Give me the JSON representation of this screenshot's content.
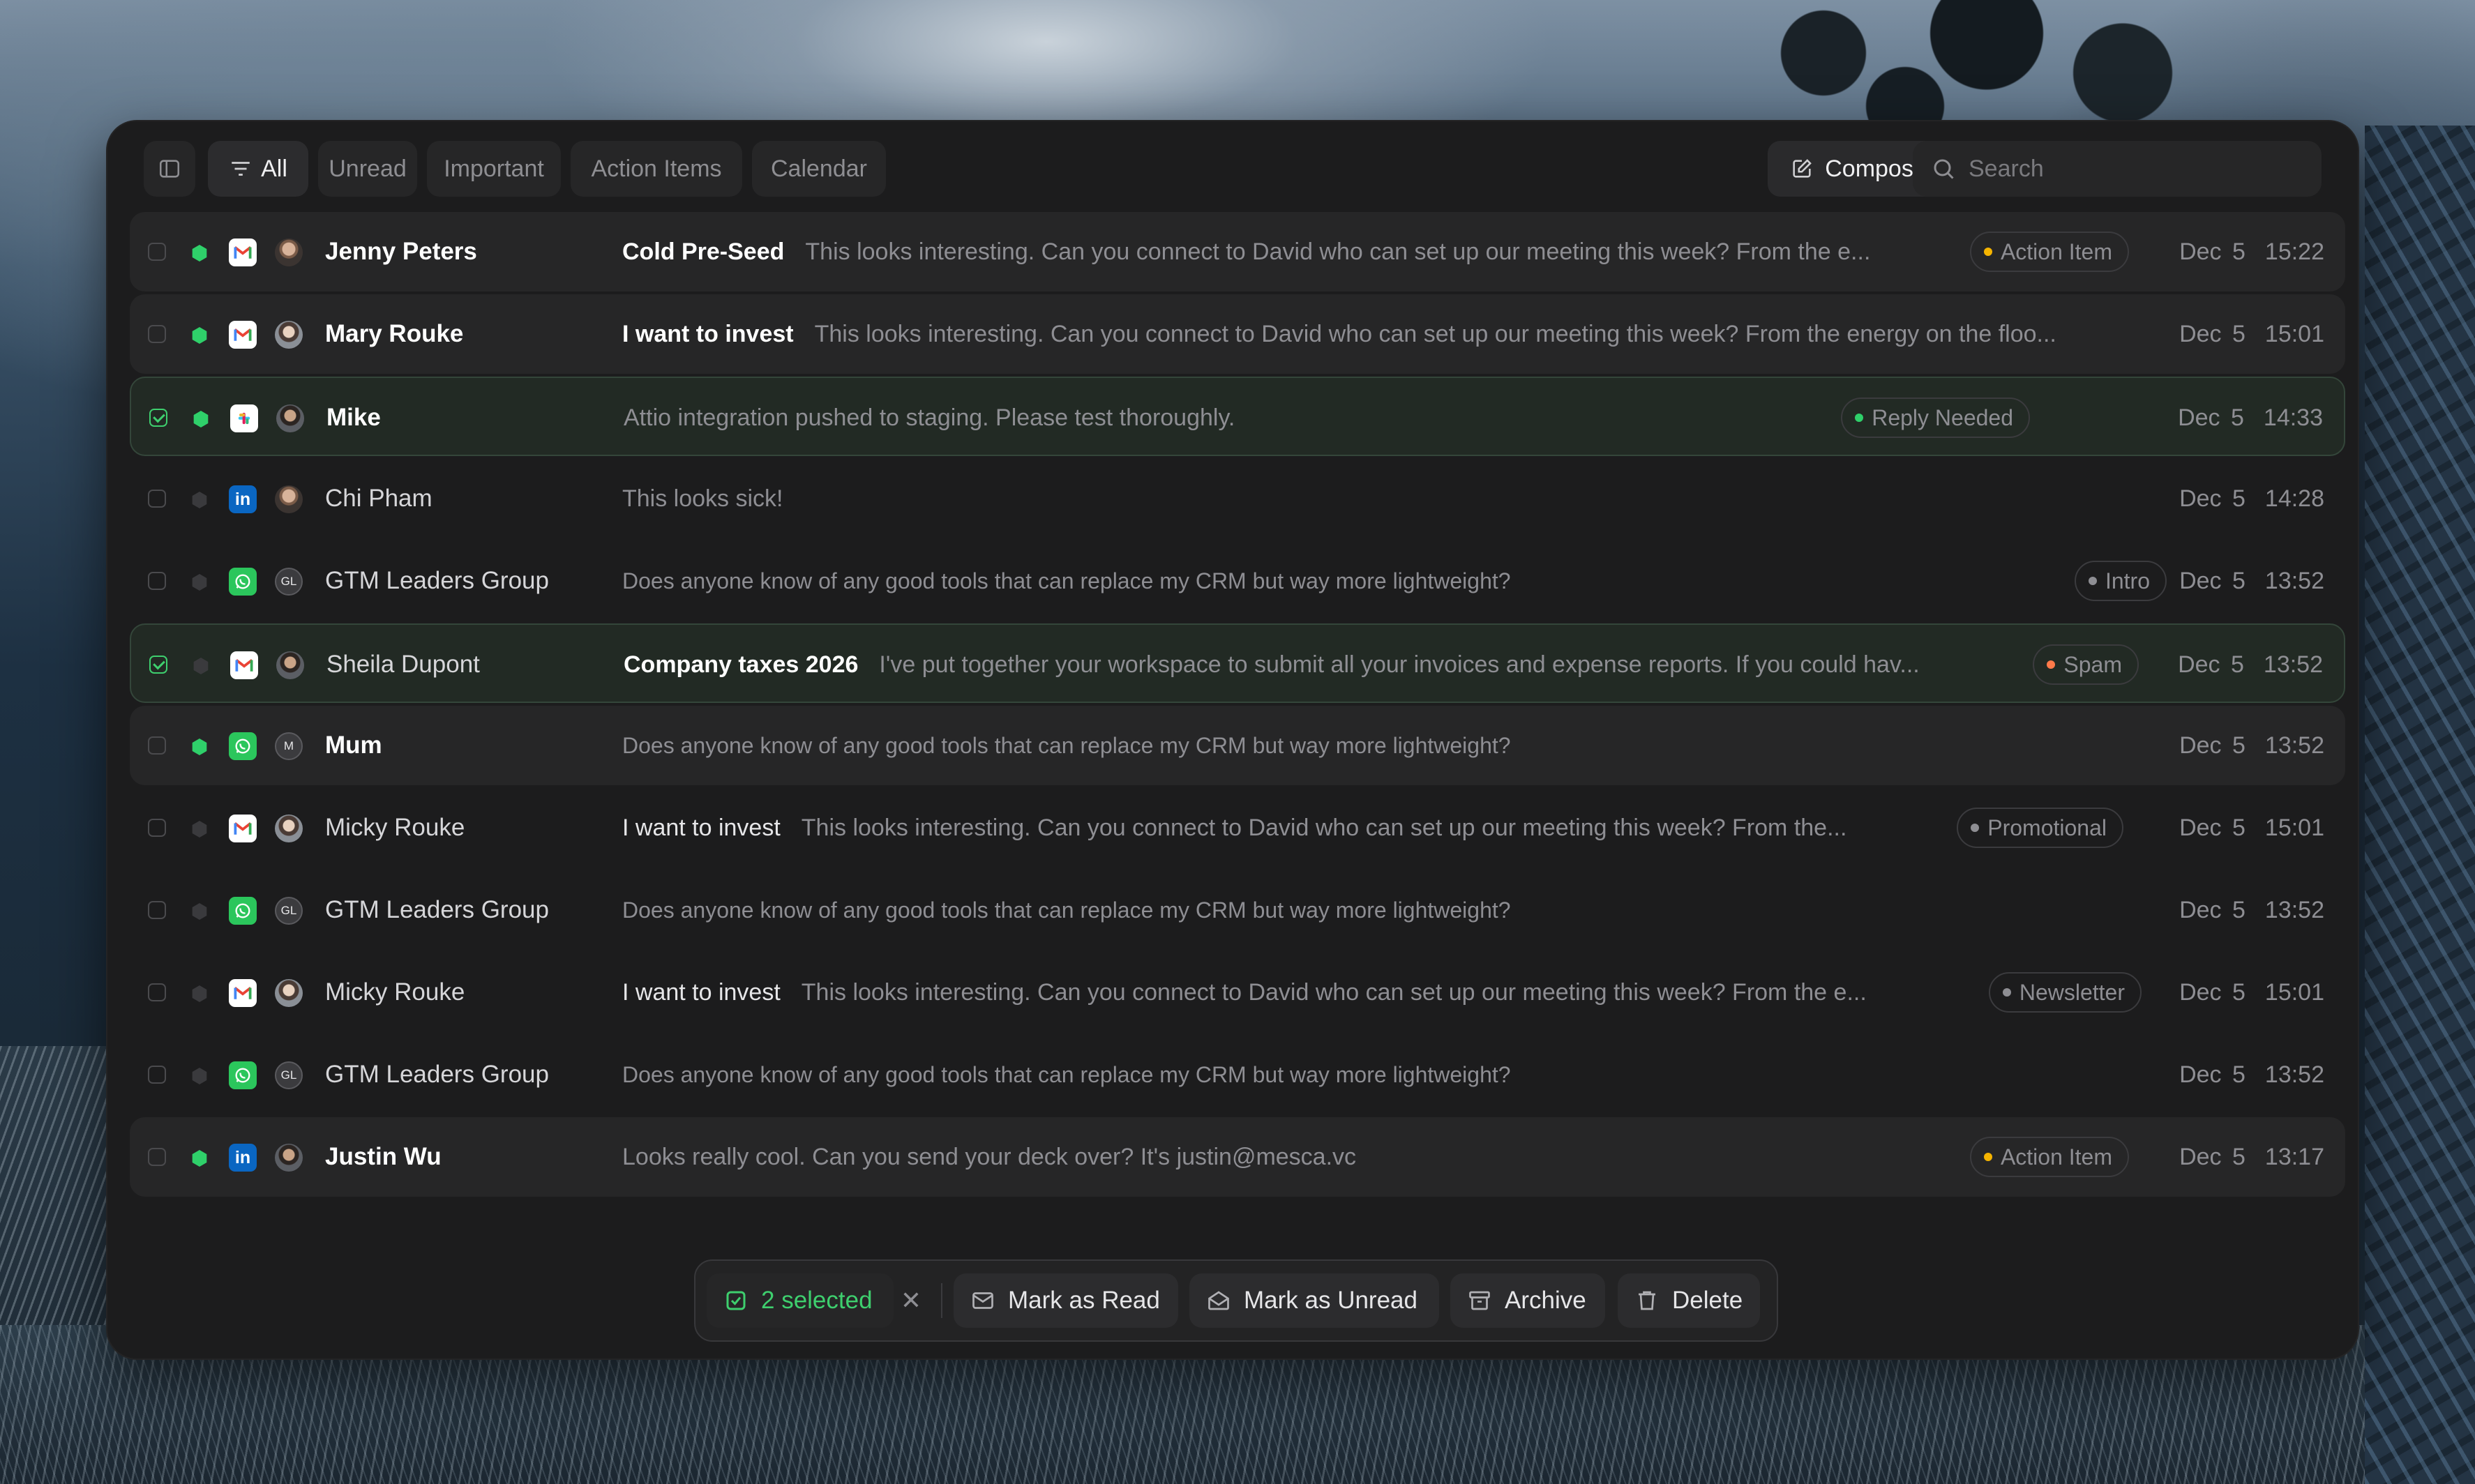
{
  "toolbar": {
    "filters": [
      "All",
      "Unread",
      "Important",
      "Action Items",
      "Calendar"
    ],
    "compose_label": "Compose",
    "search_placeholder": "Search"
  },
  "colors": {
    "unread_dot": "#2fd06a",
    "selected_accent": "#3ecf6e",
    "tag_action_item": "#f5b400",
    "tag_reply_needed": "#2fd06a",
    "tag_spam": "#ff7a4a",
    "tag_neutral": "#8e8e93"
  },
  "messages": [
    {
      "checked": false,
      "unread": true,
      "app": "gmail",
      "avatar": "photo",
      "sender": "Jenny Peters",
      "subject": "Cold Pre-Seed",
      "preview": "This looks interesting. Can you connect to David who can set up our meeting this week? From the e...",
      "tag": "Action Item",
      "tag_color": "action",
      "date": "Dec 5",
      "time": "15:22"
    },
    {
      "checked": false,
      "unread": true,
      "app": "gmail",
      "avatar": "photo2",
      "sender": "Mary Rouke",
      "subject": "I want to invest",
      "preview": "This looks interesting. Can you connect to David who can set up our meeting this week? From the energy on the floo...",
      "tag": "",
      "tag_color": "",
      "date": "Dec 5",
      "time": "15:01"
    },
    {
      "checked": true,
      "unread": true,
      "app": "slack",
      "avatar": "photo3",
      "sender": "Mike",
      "subject": "",
      "preview": "Attio integration pushed to staging. Please test thoroughly.",
      "tag": "Reply Needed",
      "tag_color": "reply",
      "date": "Dec 5",
      "time": "14:33"
    },
    {
      "checked": false,
      "unread": false,
      "app": "linkedin",
      "avatar": "photo",
      "sender": "Chi Pham",
      "subject": "",
      "preview": "This looks sick!",
      "tag": "",
      "tag_color": "",
      "date": "Dec 5",
      "time": "14:28"
    },
    {
      "checked": false,
      "unread": false,
      "app": "whatsapp",
      "avatar": "GL",
      "sender": "GTM Leaders Group",
      "subject": "",
      "preview": "Does anyone know of any good tools that can replace my CRM but way more lightweight?",
      "tag": "Intro",
      "tag_color": "neutral",
      "date": "Dec 5",
      "time": "13:52"
    },
    {
      "checked": true,
      "unread": false,
      "app": "gmail",
      "avatar": "photo3",
      "sender": "Sheila Dupont",
      "subject": "Company taxes 2026",
      "preview": "I've put together your workspace to submit all your invoices and expense reports. If you could hav...",
      "tag": "Spam",
      "tag_color": "spam",
      "date": "Dec 5",
      "time": "13:52"
    },
    {
      "checked": false,
      "unread": true,
      "app": "whatsapp",
      "avatar": "M",
      "sender": "Mum",
      "subject": "",
      "preview": "Does anyone know of any good tools that can replace my CRM but way more lightweight?",
      "tag": "",
      "tag_color": "",
      "date": "Dec 5",
      "time": "13:52"
    },
    {
      "checked": false,
      "unread": false,
      "app": "gmail",
      "avatar": "photo2",
      "sender": "Micky Rouke",
      "subject": "I want to invest",
      "preview": "This looks interesting. Can you connect to David who can set up our meeting this week? From the...",
      "tag": "Promotional",
      "tag_color": "neutral",
      "date": "Dec 5",
      "time": "15:01"
    },
    {
      "checked": false,
      "unread": false,
      "app": "whatsapp",
      "avatar": "GL",
      "sender": "GTM Leaders Group",
      "subject": "",
      "preview": "Does anyone know of any good tools that can replace my CRM but way more lightweight?",
      "tag": "",
      "tag_color": "",
      "date": "Dec 5",
      "time": "13:52"
    },
    {
      "checked": false,
      "unread": false,
      "app": "gmail",
      "avatar": "photo2",
      "sender": "Micky Rouke",
      "subject": "I want to invest",
      "preview": "This looks interesting. Can you connect to David who can set up our meeting this week? From the e...",
      "tag": "Newsletter",
      "tag_color": "neutral",
      "date": "Dec 5",
      "time": "15:01"
    },
    {
      "checked": false,
      "unread": false,
      "app": "whatsapp",
      "avatar": "GL",
      "sender": "GTM Leaders Group",
      "subject": "",
      "preview": "Does anyone know of any good tools that can replace my CRM but way more lightweight?",
      "tag": "",
      "tag_color": "",
      "date": "Dec 5",
      "time": "13:52"
    },
    {
      "checked": false,
      "unread": true,
      "app": "linkedin",
      "avatar": "photo3",
      "sender": "Justin Wu",
      "subject": "",
      "preview": "Looks really cool. Can you send your deck over? It's justin@mesca.vc",
      "tag": "Action Item",
      "tag_color": "action",
      "date": "Dec 5",
      "time": "13:17"
    }
  ],
  "action_bar": {
    "selected_label": "2 selected",
    "mark_read": "Mark as Read",
    "mark_unread": "Mark as Unread",
    "archive": "Archive",
    "delete": "Delete"
  }
}
